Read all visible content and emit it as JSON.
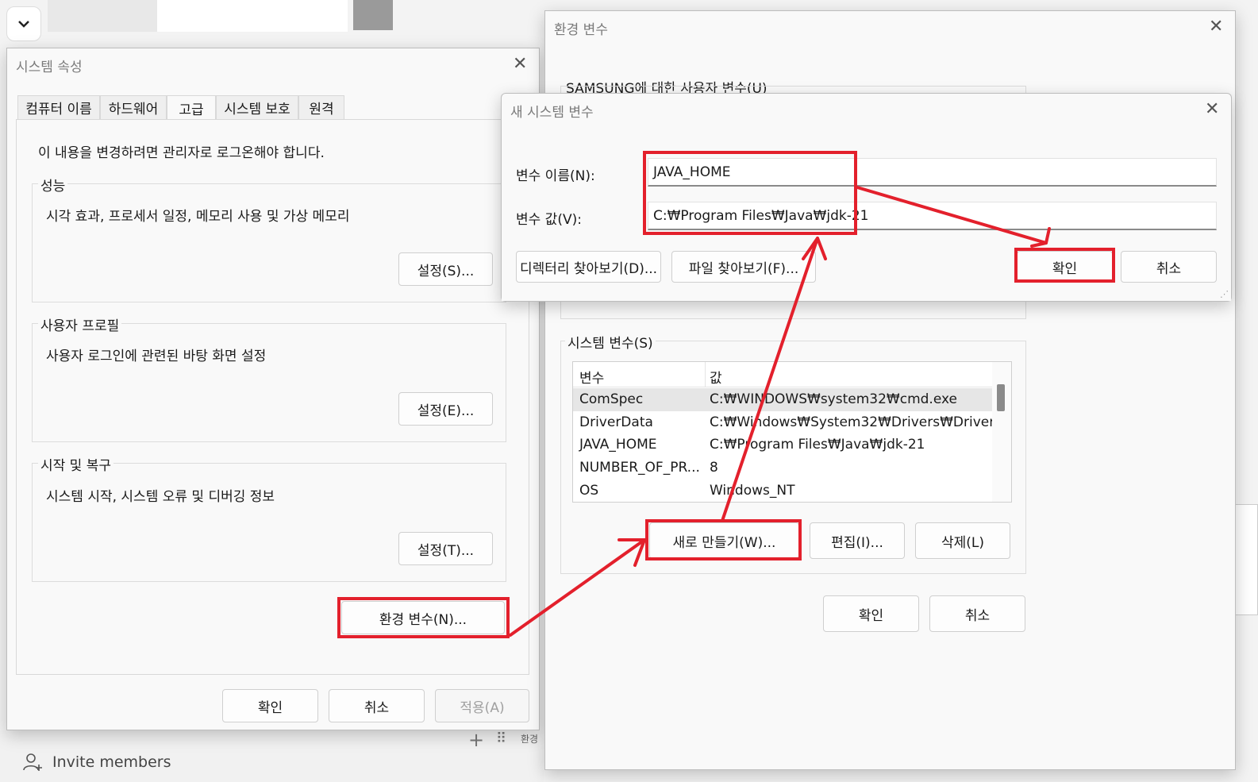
{
  "background": {
    "invite_label": "Invite members",
    "taskbar_hint": "환경"
  },
  "sys_props": {
    "title": "시스템 속성",
    "tabs": [
      "컴퓨터 이름",
      "하드웨어",
      "고급",
      "시스템 보호",
      "원격"
    ],
    "active_tab": 2,
    "admin_notice": "이 내용을 변경하려면 관리자로 로그온해야 합니다.",
    "groups": [
      {
        "label": "성능",
        "desc": "시각 효과, 프로세서 일정, 메모리 사용 및 가상 메모리",
        "button": "설정(S)..."
      },
      {
        "label": "사용자 프로필",
        "desc": "사용자 로그인에 관련된 바탕 화면 설정",
        "button": "설정(E)..."
      },
      {
        "label": "시작 및 복구",
        "desc": "시스템 시작, 시스템 오류 및 디버깅 정보",
        "button": "설정(T)..."
      }
    ],
    "env_button": "환경 변수(N)...",
    "ok": "확인",
    "cancel": "취소",
    "apply": "적용(A)"
  },
  "env_vars": {
    "title": "환경 변수",
    "user_vars_label": "SAMSUNG에 대한 사용자 변수(U)",
    "system_vars_label": "시스템 변수(S)",
    "columns": [
      "변수",
      "값"
    ],
    "rows": [
      {
        "name": "ComSpec",
        "value": "C:₩WINDOWS₩system32₩cmd.exe"
      },
      {
        "name": "DriverData",
        "value": "C:₩Windows₩System32₩Drivers₩Driver..."
      },
      {
        "name": "JAVA_HOME",
        "value": "C:₩Program Files₩Java₩jdk-21"
      },
      {
        "name": "NUMBER_OF_PR...",
        "value": "8"
      },
      {
        "name": "OS",
        "value": "Windows_NT"
      }
    ],
    "selected_row": 0,
    "new_button": "새로 만들기(W)...",
    "edit_button": "편집(I)...",
    "delete_button": "삭제(L)",
    "ok": "확인",
    "cancel": "취소"
  },
  "new_var": {
    "title": "새 시스템 변수",
    "name_label": "변수 이름(N):",
    "value_label": "변수 값(V):",
    "name_value": "JAVA_HOME",
    "value_value": "C:₩Program Files₩Java₩jdk-21",
    "browse_dir": "디렉터리 찾아보기(D)...",
    "browse_file": "파일 찾아보기(F)...",
    "ok": "확인",
    "cancel": "취소"
  },
  "annotation_color": "#e3202c"
}
